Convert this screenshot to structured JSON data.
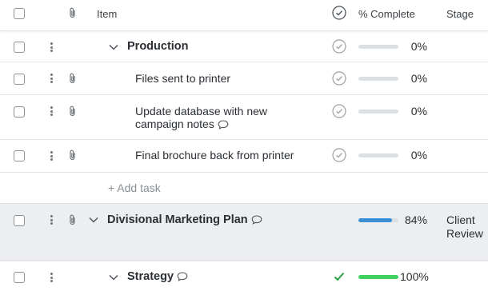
{
  "header": {
    "item": "Item",
    "complete": "% Complete",
    "stage": "Stage"
  },
  "rows": [
    {
      "label": "Production",
      "pct": "0%"
    },
    {
      "label": "Files sent to printer",
      "pct": "0%"
    },
    {
      "label": "Update database with new",
      "label2": "campaign notes",
      "pct": "0%"
    },
    {
      "label": "Final brochure back from printer",
      "pct": "0%"
    },
    {
      "label": "+ Add task"
    },
    {
      "label": "Divisional Marketing Plan",
      "pct": "84%",
      "progress": 0.84,
      "stage": "Client",
      "stage2": "Review"
    },
    {
      "label": "Strategy",
      "pct": "100%",
      "progress": 1.0
    }
  ],
  "colors": {
    "progress_blue": "#3b8ed4",
    "progress_green": "#3ed15f",
    "check_green": "#2f9e44",
    "group_bg": "#eceef0"
  }
}
